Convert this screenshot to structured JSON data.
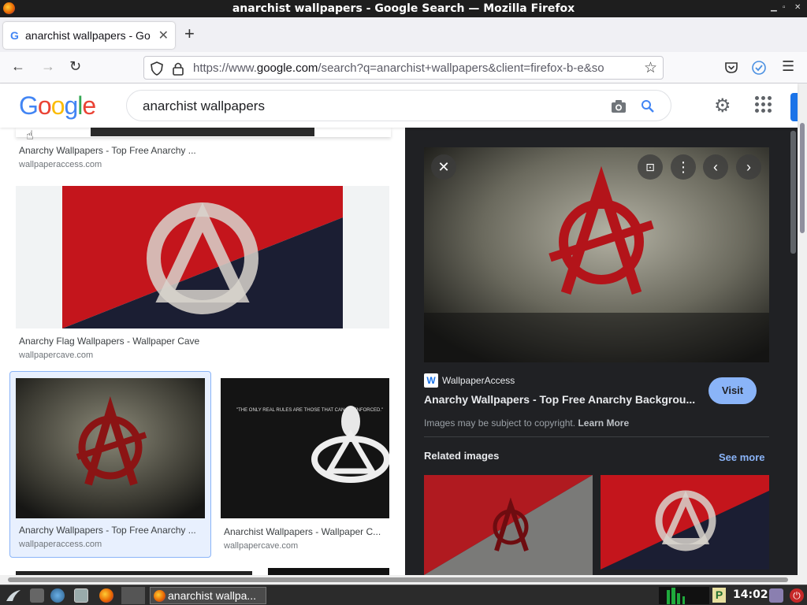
{
  "window": {
    "title": "anarchist wallpapers - Google Search — Mozilla Firefox"
  },
  "tab": {
    "label": "anarchist wallpapers - Go",
    "favicon": "G"
  },
  "url": {
    "prefix": "https://www.",
    "domain": "google.com",
    "rest": "/search?q=anarchist+wallpapers&client=firefox-b-e&so"
  },
  "google": {
    "logo": [
      "G",
      "o",
      "o",
      "g",
      "l",
      "e"
    ],
    "logo_colors": [
      "#4285f4",
      "#ea4335",
      "#fbbc05",
      "#4285f4",
      "#34a853",
      "#ea4335"
    ],
    "query": "anarchist wallpapers"
  },
  "results": [
    {
      "caption": "Anarchy Wallpapers - Top Free Anarchy ...",
      "site": "wallpaperaccess.com"
    },
    {
      "caption": "Anarchy Flag Wallpapers - Wallpaper Cave",
      "site": "wallpapercave.com"
    },
    {
      "caption": "Anarchy Wallpapers - Top Free Anarchy ...",
      "site": "wallpaperaccess.com"
    },
    {
      "caption": "Anarchist Wallpapers - Wallpaper C...",
      "site": "wallpapercave.com"
    }
  ],
  "quote_image_text": "\"THE ONLY REAL RULES ARE THOSE THAT CAN BE ENFORCED.\"",
  "panel": {
    "source_icon": "W",
    "source": "WallpaperAccess",
    "title": "Anarchy Wallpapers - Top Free Anarchy Backgrou...",
    "visit": "Visit",
    "copyright": "Images may be subject to copyright.",
    "learn_more": "Learn More",
    "related": "Related images",
    "see_more": "See more"
  },
  "taskbar": {
    "task_label": "anarchist wallpa...",
    "clock": "14:02",
    "tray_p": "P"
  },
  "colors": {
    "google_blue": "#1a73e8",
    "panel_bg": "#202124",
    "visit_bg": "#8ab4f8"
  }
}
